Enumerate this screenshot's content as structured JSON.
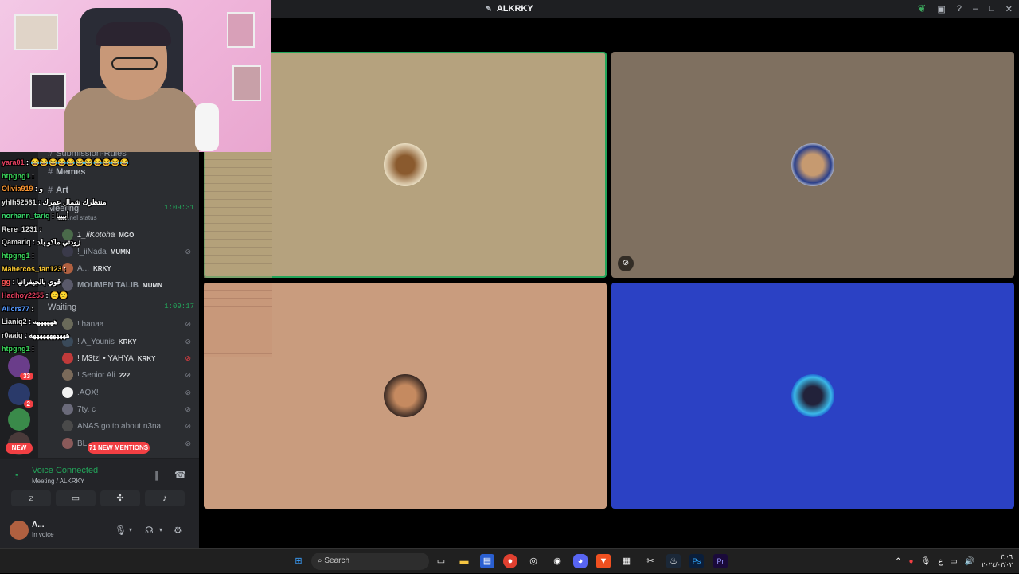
{
  "window": {
    "title": "ALKRKY"
  },
  "chat_overlay": [
    {
      "user": "yara01",
      "text": "😂😂😂😂😂😂😂😂😂😂😂",
      "color": "#e84060"
    },
    {
      "user": "htpgng1",
      "text": "",
      "color": "#3ad65a"
    },
    {
      "user": "Olivia919",
      "text": "و",
      "color": "#ff9933"
    },
    {
      "user": "yhlh52561",
      "text": "منتظرك شمال عمرك",
      "color": "#dddddd"
    },
    {
      "user": "norhann_tariq",
      "text": "أبيييا",
      "color": "#38d96b"
    },
    {
      "user": "Rere_1231",
      "text": "",
      "color": "#dddddd"
    },
    {
      "user": "Qamariq",
      "text": "زودتي ماكو بلد",
      "color": "#dddddd"
    },
    {
      "user": "htpgng1",
      "text": "",
      "color": "#3ad65a"
    },
    {
      "user": "Mahercos_fan123",
      "text": "",
      "color": "#ffcc33"
    },
    {
      "user": "gg",
      "text": "قوي بالجيفرانيا",
      "color": "#ff5555"
    },
    {
      "user": "Hadhoy2255",
      "text": "🙁🙁",
      "color": "#e84060"
    },
    {
      "user": "Allcrs77",
      "text": "",
      "color": "#5599ff"
    },
    {
      "user": "Lianiq2",
      "text": "ههههههه",
      "color": "#dddddd"
    },
    {
      "user": "r0aaiq",
      "text": "هههههههههههه",
      "color": "#dddddd"
    },
    {
      "user": "htpgng1",
      "text": "",
      "color": "#3ad65a"
    }
  ],
  "channels": {
    "text_channels": [
      "Submission-Rules",
      "Memes",
      "Art"
    ],
    "meeting": {
      "name": "Meeting",
      "timer": "1:09:31",
      "status": "channel status"
    },
    "meeting_members": [
      {
        "name": "1_iiKotoha",
        "tag": "MGO"
      },
      {
        "name": "!_iiNada",
        "tag": "MUMN"
      },
      {
        "name": "A...",
        "tag": "KRKY"
      },
      {
        "name": "MOUMEN TALIB",
        "tag": "MUMN"
      }
    ],
    "waiting": {
      "name": "Waiting",
      "timer": "1:09:17"
    },
    "waiting_members": [
      {
        "name": "! hanaa",
        "tag": ""
      },
      {
        "name": "! A_Younis",
        "tag": "KRKY"
      },
      {
        "name": "! M3tzl • YAHYA",
        "tag": "KRKY"
      },
      {
        "name": "! Senior Ali",
        "tag": "222"
      },
      {
        "name": ".AQX!",
        "tag": ""
      },
      {
        "name": "7ty. c",
        "tag": ""
      },
      {
        "name": "ANAS go to about n3na",
        "tag": ""
      },
      {
        "name": "BL...",
        "tag": ""
      }
    ],
    "mentions_label": "71 NEW MENTIONS"
  },
  "servers": {
    "badges": [
      "33",
      "2"
    ],
    "new_label": "NEW"
  },
  "voice_panel": {
    "status": "Voice Connected",
    "location": "Meeting / ALKRKY"
  },
  "user_panel": {
    "name": "A...",
    "status": "In voice"
  },
  "tiles": [
    {
      "bg": "#b5a27e"
    },
    {
      "bg": "#7f7060"
    },
    {
      "bg": "#c99c7e"
    },
    {
      "bg": "#2b41c4"
    }
  ],
  "taskbar": {
    "search_placeholder": "Search",
    "clock_time": "٣:٠٦",
    "clock_date": "٢٠٢٤/٠٣/٠٢"
  }
}
